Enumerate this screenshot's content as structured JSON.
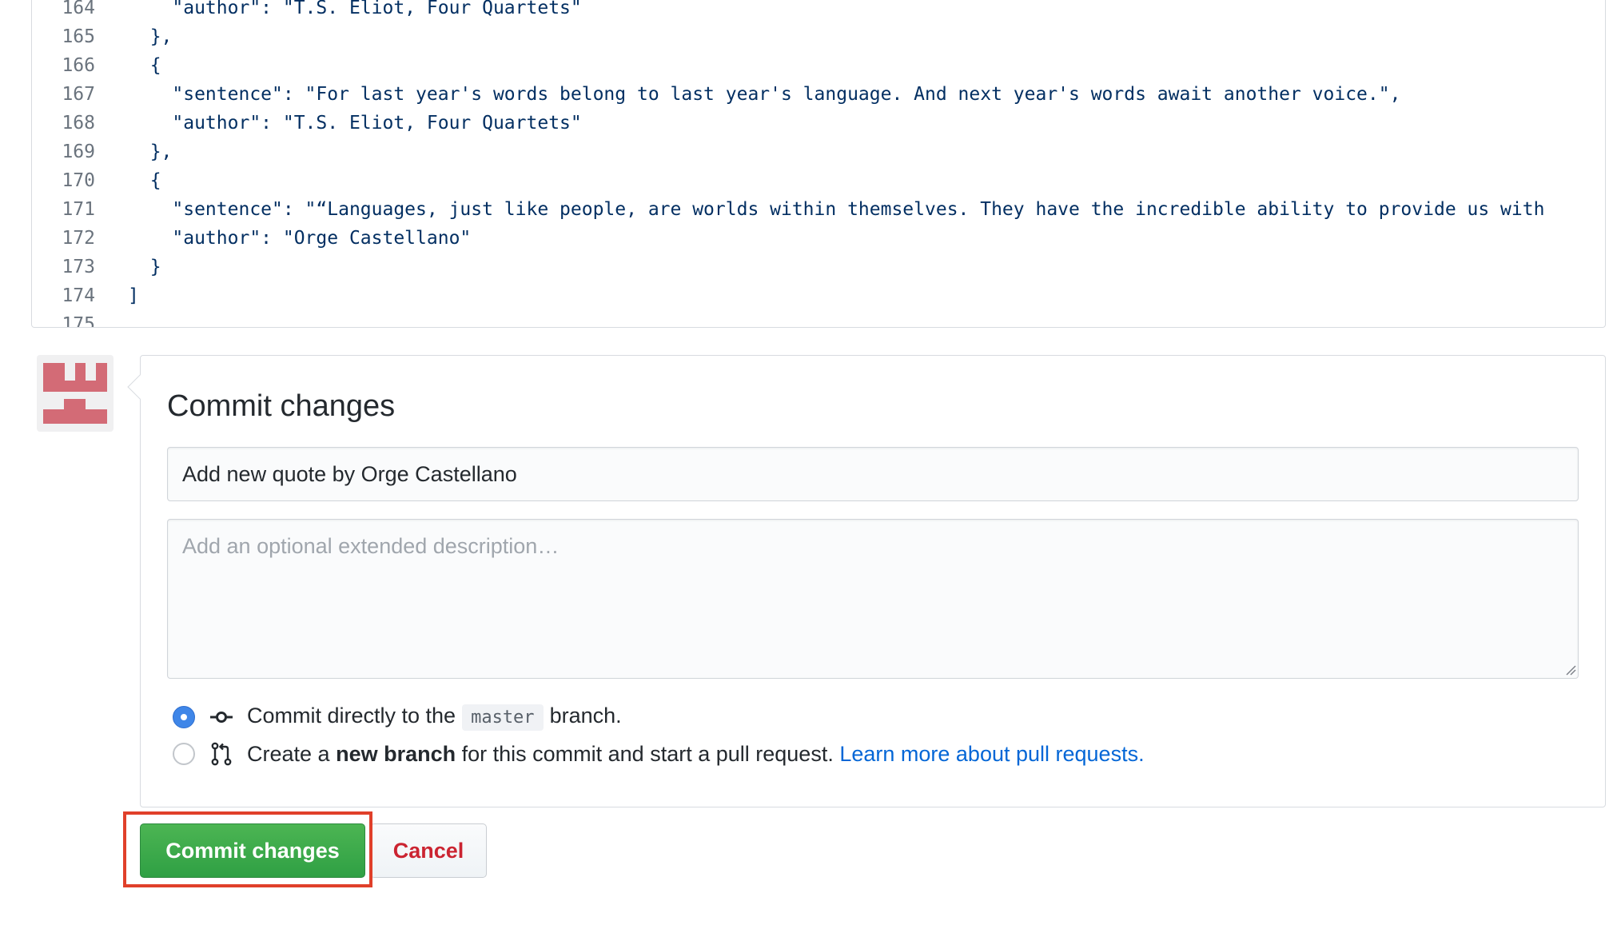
{
  "editor": {
    "lines": [
      {
        "num": "164",
        "code": "    \"author\": \"T.S. Eliot, Four Quartets\""
      },
      {
        "num": "165",
        "code": "  },"
      },
      {
        "num": "166",
        "code": "  {"
      },
      {
        "num": "167",
        "code": "    \"sentence\": \"For last year's words belong to last year's language. And next year's words await another voice.\","
      },
      {
        "num": "168",
        "code": "    \"author\": \"T.S. Eliot, Four Quartets\""
      },
      {
        "num": "169",
        "code": "  },"
      },
      {
        "num": "170",
        "code": "  {"
      },
      {
        "num": "171",
        "code": "    \"sentence\": \"“Languages, just like people, are worlds within themselves. They have the incredible ability to provide us with"
      },
      {
        "num": "172",
        "code": "    \"author\": \"Orge Castellano\""
      },
      {
        "num": "173",
        "code": "  }"
      },
      {
        "num": "174",
        "code": "]"
      },
      {
        "num": "175",
        "code": ""
      }
    ]
  },
  "commit": {
    "title": "Commit changes",
    "summary_value": "Add new quote by Orge Castellano",
    "description_placeholder": "Add an optional extended description…",
    "option_direct": {
      "prefix": "Commit directly to the",
      "branch": "master",
      "suffix": "branch.",
      "checked": true,
      "icon": "git-commit-icon"
    },
    "option_new_branch": {
      "prefix": "Create a",
      "strong": "new branch",
      "suffix": "for this commit and start a pull request.",
      "link": "Learn more about pull requests.",
      "checked": false,
      "icon": "git-pull-request-icon"
    }
  },
  "buttons": {
    "commit_label": "Commit changes",
    "cancel_label": "Cancel"
  },
  "colors": {
    "commit_button": "#2fa044",
    "cancel_text": "#cb2431",
    "link": "#0366d6",
    "highlight_box": "#e0402a",
    "avatar": "#d36b76",
    "radio_checked": "#3f86e8"
  }
}
